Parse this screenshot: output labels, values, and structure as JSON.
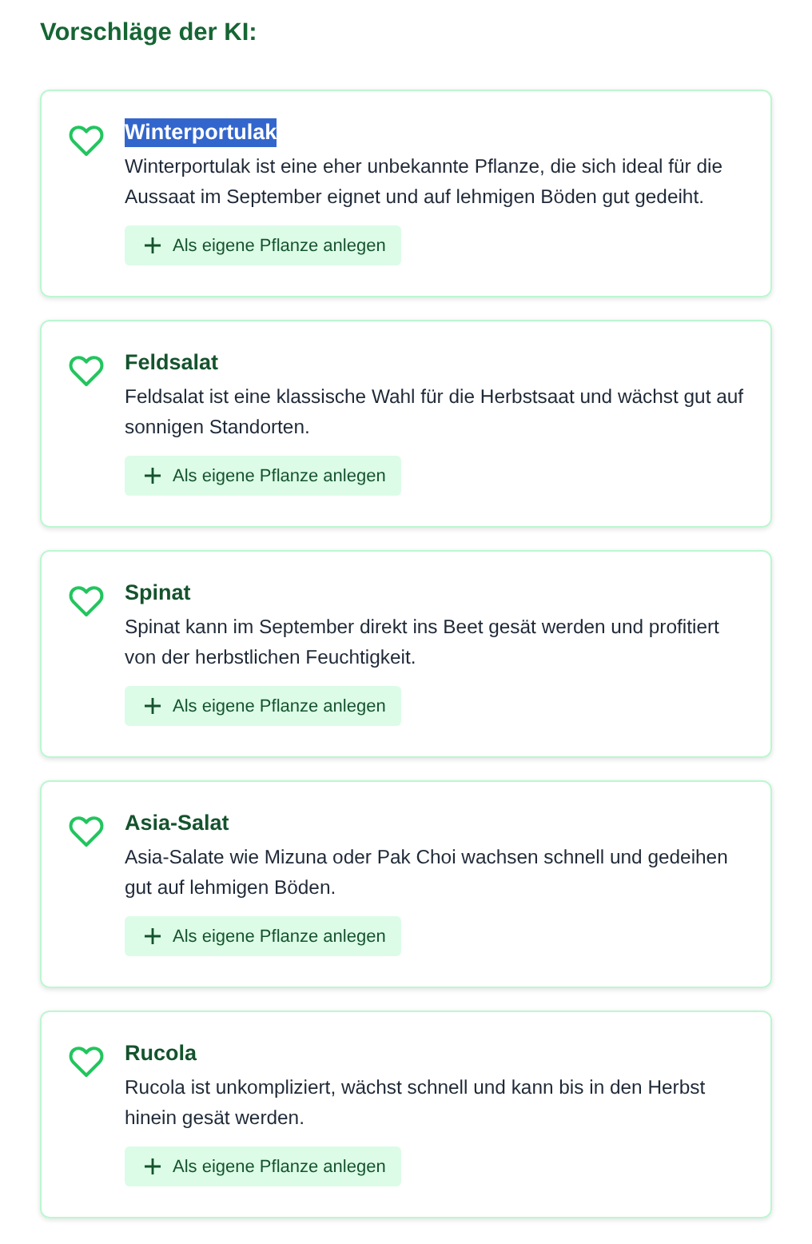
{
  "heading": "Vorschläge der KI:",
  "suggestions": [
    {
      "title": "Winterportulak",
      "title_selected": true,
      "description": "Winterportulak ist eine eher unbekannte Pflanze, die sich ideal für die Aussaat im September eignet und auf lehmigen Böden gut gedeiht.",
      "button": "Als eigene Pflanze anlegen"
    },
    {
      "title": "Feldsalat",
      "title_selected": false,
      "description": "Feldsalat ist eine klassische Wahl für die Herbstsaat und wächst gut auf sonnigen Standorten.",
      "button": "Als eigene Pflanze anlegen"
    },
    {
      "title": "Spinat",
      "title_selected": false,
      "description": "Spinat kann im September direkt ins Beet gesät werden und profitiert von der herbstlichen Feuchtigkeit.",
      "button": "Als eigene Pflanze anlegen"
    },
    {
      "title": "Asia-Salat",
      "title_selected": false,
      "description": "Asia-Salate wie Mizuna oder Pak Choi wachsen schnell und gedeihen gut auf lehmigen Böden.",
      "button": "Als eigene Pflanze anlegen"
    },
    {
      "title": "Rucola",
      "title_selected": false,
      "description": "Rucola ist unkompliziert, wächst schnell und kann bis in den Herbst hinein gesät werden.",
      "button": "Als eigene Pflanze anlegen"
    }
  ]
}
